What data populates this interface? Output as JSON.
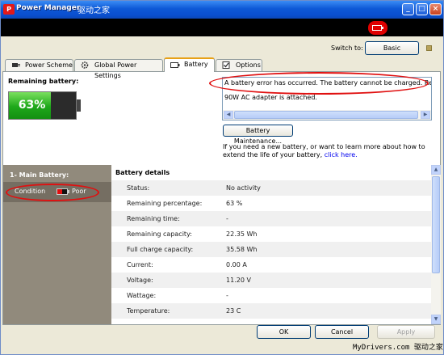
{
  "window": {
    "title": "Power Manager",
    "app_icon": "power-manager-icon",
    "watermark_top": "驱动之家",
    "controls": [
      "minimize-icon",
      "maximize-icon",
      "close-icon"
    ],
    "accent": "#0d58d6"
  },
  "header": {
    "alert_icon": "battery-alert-icon",
    "alert_color": "#e00000"
  },
  "switch": {
    "label": "Switch to:",
    "button": "Basic"
  },
  "tabs": [
    {
      "label": "Power Scheme",
      "icon": "power-plug-icon"
    },
    {
      "label": "Global Power Settings",
      "icon": "gear-icon"
    },
    {
      "label": "Battery",
      "icon": "battery-icon",
      "active": true
    },
    {
      "label": "Options",
      "icon": "checkbox-icon"
    }
  ],
  "battery": {
    "remaining_label": "Remaining battery:",
    "percent_text": "63%",
    "percent_value": 63,
    "fill_color": "#1ea81a"
  },
  "error": {
    "line1": "A battery error has occurred. The battery cannot be charged. Replace",
    "line2": "90W AC adapter is attached."
  },
  "maintenance_button": "Battery Maintenance...",
  "help": {
    "text": "If you need a new battery, or want to learn more about how to extend the life of your battery,",
    "link": "click here."
  },
  "main_battery": {
    "heading": "1- Main Battery:",
    "condition_label": "Condition",
    "condition_value": "Poor",
    "condition_color": "#e01010"
  },
  "details": {
    "heading": "Battery details",
    "rows": [
      {
        "key": "Status:",
        "value": "No activity"
      },
      {
        "key": "Remaining percentage:",
        "value": "63 %"
      },
      {
        "key": "Remaining time:",
        "value": "-"
      },
      {
        "key": "Remaining capacity:",
        "value": "22.35 Wh"
      },
      {
        "key": "Full charge capacity:",
        "value": "35.58 Wh"
      },
      {
        "key": "Current:",
        "value": "0.00 A"
      },
      {
        "key": "Voltage:",
        "value": "11.20 V"
      },
      {
        "key": "Wattage:",
        "value": "-"
      },
      {
        "key": "Temperature:",
        "value": "23 C"
      }
    ]
  },
  "footer": {
    "ok": "OK",
    "cancel": "Cancel",
    "apply": "Apply"
  },
  "watermark_bottom": "MyDrivers.com 驱动之家"
}
